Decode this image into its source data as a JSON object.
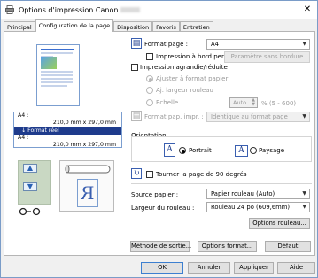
{
  "window": {
    "title": "Options d'impression Canon"
  },
  "tabs": [
    "Principal",
    "Configuration de la page",
    "Disposition",
    "Favoris",
    "Entretien"
  ],
  "preview": {
    "size_label_1": "A4 :",
    "size_dim_1": "210,0 mm x 297,0 mm",
    "selected": "Format réel",
    "size_label_2": "A4 :",
    "size_dim_2": "210,0 mm x 297,0 mm"
  },
  "page_setup": {
    "format_label": "Format page :",
    "format_value": "A4",
    "borderless_label": "Impression à bord perdu",
    "borderless_btn": "Paramètre sans bordure",
    "scaled_label": "Impression agrandie/réduite",
    "fit_label": "Ajuster à format papier",
    "roll_width_label": "Aj. largeur rouleau",
    "scale_label": "Echelle",
    "scale_value": "Auto",
    "scale_unit": "% (5 - 600)",
    "format_paper_label": "Format pap. impr. :",
    "format_paper_value": "Identique au format page",
    "orientation_label": "Orientation",
    "portrait_label": "Portrait",
    "landscape_label": "Paysage",
    "rotate_label": "Tourner la page de 90 degrés",
    "source_label": "Source papier :",
    "source_value": "Papier rouleau (Auto)",
    "width_label": "Largeur du rouleau :",
    "width_value": "Rouleau 24 po (609,6mm)",
    "roll_options_btn": "Options rouleau..."
  },
  "footer": {
    "output_method": "Méthode de sortie...",
    "format_options": "Options format...",
    "default": "Défaut",
    "ok": "OK",
    "cancel": "Annuler",
    "apply": "Appliquer",
    "help": "Aide"
  }
}
